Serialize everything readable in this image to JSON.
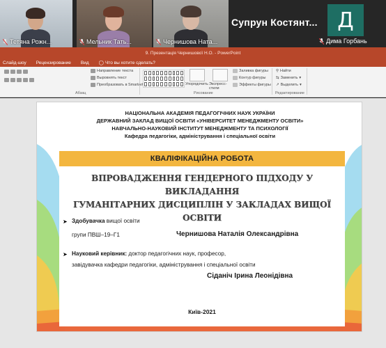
{
  "meeting": {
    "participants": [
      {
        "name": "Тетяна Рожн..."
      },
      {
        "name": "Мельник Тать..."
      },
      {
        "name": "Чернишова Ната..."
      }
    ],
    "active_speaker": "Супрун  Костянт...",
    "avatar": {
      "initial": "Д",
      "name": "Дима Горбань",
      "color": "#1e6e63"
    }
  },
  "powerpoint": {
    "title": "9. Презентація Чернишової Н.О. - PowerPoint",
    "menu": [
      "Слайд-шоу",
      "Рецензирование",
      "Вид",
      "Что вы хотите сделать?"
    ],
    "ribbon": {
      "paragraph": {
        "items": [
          "Направление текста",
          "Выровнять текст",
          "Преобразовать в SmartArt"
        ],
        "group_label": "Абзац"
      },
      "drawing": {
        "arrange_label": "Упорядочить",
        "quick_styles_label": "Экспресс-стили",
        "items": [
          "Заливка фигуры",
          "Контур фигуры",
          "Эффекты фигуры"
        ],
        "group_label": "Рисование"
      },
      "editing": {
        "items": [
          "Найти",
          "Заменить",
          "Выделить"
        ],
        "group_label": "Редактирование"
      }
    },
    "accent_color": "#b7472a"
  },
  "slide": {
    "header": [
      "НАЦІОНАЛЬНА АКАДЕМІЯ ПЕДАГОГІЧНИХ НАУК УКРАЇНИ",
      "ДЕРЖАВНИЙ ЗАКЛАД ВИЩОЇ ОСВІТИ  «УНІВЕРСИТЕТ МЕНЕДЖМЕНТУ ОСВІТИ»",
      "НАВЧАЛЬНО-НАУКОВИЙ ІНСТИТУТ МЕНЕДЖМЕНТУ ТА ПСИХОЛОГІЇ",
      "Кафедра педагогіки, адміністрування і спеціальної освіти"
    ],
    "band_title": "КВАЛІФІКАЦІЙНА РОБОТА",
    "topic": [
      "ВПРОВАДЖЕННЯ ГЕНДЕРНОГО ПІДХОДУ У ВИКЛАДАННЯ",
      "ГУМАНІТАРНИХ ДИСЦИПЛІН У ЗАКЛАДАХ ВИЩОЇ ОСВІТИ"
    ],
    "student": {
      "role_bold": "Здобувачка",
      "role_rest": " вищої освіти",
      "group": "групи  ПВШ–19–Г1",
      "name": "Чернишова Наталія Олександрівна"
    },
    "supervisor": {
      "label": "Науковий керівник:",
      "title1": " доктор педагогічних наук, професор,",
      "title2": "завідувачка кафедри педагогіки,  адміністрування і спеціальної освіти",
      "name": "Сіданіч Ірина Леонідівна"
    },
    "city": "Київ-2021",
    "band_color": "#f3b63f"
  }
}
